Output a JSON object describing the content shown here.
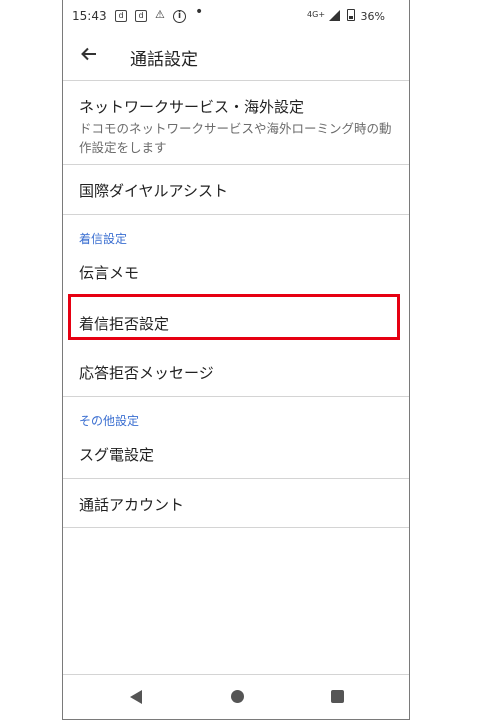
{
  "status_bar": {
    "time": "15:43",
    "icon_d1": "d",
    "icon_d2": "d",
    "icon_mid": "⚠",
    "icon_info": "i",
    "dot": "•",
    "network": "4G+",
    "battery": "36%"
  },
  "appbar": {
    "title": "通話設定"
  },
  "items": {
    "network_service": {
      "label": "ネットワークサービス・海外設定",
      "summary": "ドコモのネットワークサービスや海外ローミング時の動作設定をします"
    },
    "intl_dial_assist": {
      "label": "国際ダイヤルアシスト"
    },
    "voice_memo": {
      "label": "伝言メモ"
    },
    "reject_settings": {
      "label": "着信拒否設定"
    },
    "reject_message": {
      "label": "応答拒否メッセージ"
    },
    "quick_dial": {
      "label": "スグ電設定"
    },
    "calling_accounts": {
      "label": "通話アカウント"
    }
  },
  "sections": {
    "incoming": "着信設定",
    "other": "その他設定"
  },
  "colors": {
    "accent": "#3b6fd1",
    "highlight": "#e60012"
  }
}
